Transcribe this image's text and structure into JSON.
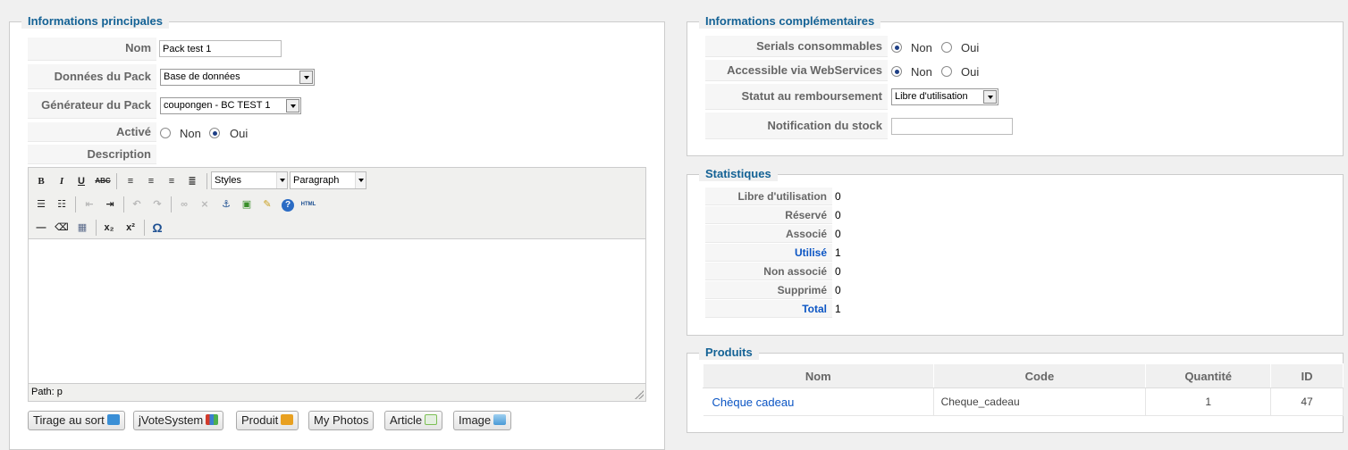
{
  "main": {
    "legend": "Informations principales",
    "nom_label": "Nom",
    "nom_value": "Pack test 1",
    "donnees_label": "Données du Pack",
    "donnees_value": "Base de données",
    "generateur_label": "Générateur du Pack",
    "generateur_value": "coupongen - BC TEST 1",
    "active_label": "Activé",
    "active_non": "Non",
    "active_oui": "Oui",
    "active_selected": "Oui",
    "description_label": "Description"
  },
  "editor": {
    "styles_value": "Styles",
    "format_value": "Paragraph",
    "status_path": "Path: p",
    "toolbar_row1": [
      "bold-icon",
      "italic-icon",
      "underline-icon",
      "strikethrough-icon",
      "align-left-icon",
      "align-center-icon",
      "align-right-icon",
      "align-justify-icon"
    ],
    "toolbar_row2": [
      "bullet-list-icon",
      "numbered-list-icon",
      "outdent-icon",
      "indent-icon",
      "undo-icon",
      "redo-icon",
      "link-icon",
      "unlink-icon",
      "anchor-icon",
      "image-icon",
      "cleanup-icon",
      "help-icon",
      "html-icon"
    ],
    "toolbar_row3": [
      "horizontal-rule-icon",
      "remove-format-icon",
      "table-icon",
      "subscript-icon",
      "superscript-icon",
      "special-char-icon"
    ]
  },
  "editor_buttons": [
    {
      "label": "Tirage au sort",
      "icon": "lottery-icon",
      "color": "#3a8fd6"
    },
    {
      "label": "jVoteSystem",
      "icon": "vote-icon",
      "color": "#d23a2a"
    },
    {
      "label": "Produit",
      "icon": "product-icon",
      "color": "#e8a020"
    },
    {
      "label": "My Photos",
      "icon": "",
      "color": ""
    },
    {
      "label": "Article",
      "icon": "article-icon",
      "color": "#7cbf54"
    },
    {
      "label": "Image",
      "icon": "image-icon",
      "color": "#4a9ad6"
    }
  ],
  "extra": {
    "legend": "Informations complémentaires",
    "serials_label": "Serials consommables",
    "serials_selected": "Non",
    "webservices_label": "Accessible via WebServices",
    "webservices_selected": "Non",
    "non": "Non",
    "oui": "Oui",
    "statut_label": "Statut au remboursement",
    "statut_value": "Libre d'utilisation",
    "notification_label": "Notification du stock",
    "notification_value": ""
  },
  "stats": {
    "legend": "Statistiques",
    "rows": [
      {
        "label": "Libre d'utilisation",
        "value": "0",
        "highlight": false
      },
      {
        "label": "Réservé",
        "value": "0",
        "highlight": false
      },
      {
        "label": "Associé",
        "value": "0",
        "highlight": false
      },
      {
        "label": "Utilisé",
        "value": "1",
        "highlight": true
      },
      {
        "label": "Non associé",
        "value": "0",
        "highlight": false
      },
      {
        "label": "Supprimé",
        "value": "0",
        "highlight": false
      },
      {
        "label": "Total",
        "value": "1",
        "highlight": true
      }
    ]
  },
  "products": {
    "legend": "Produits",
    "columns": [
      "Nom",
      "Code",
      "Quantité",
      "ID"
    ],
    "rows": [
      {
        "nom": "Chèque cadeau",
        "code": "Cheque_cadeau",
        "quantite": "1",
        "id": "47"
      }
    ]
  },
  "colors": {
    "legend": "#146295",
    "link": "#0b55c4",
    "label": "#666666",
    "radio_selected": "#1e3f86"
  }
}
